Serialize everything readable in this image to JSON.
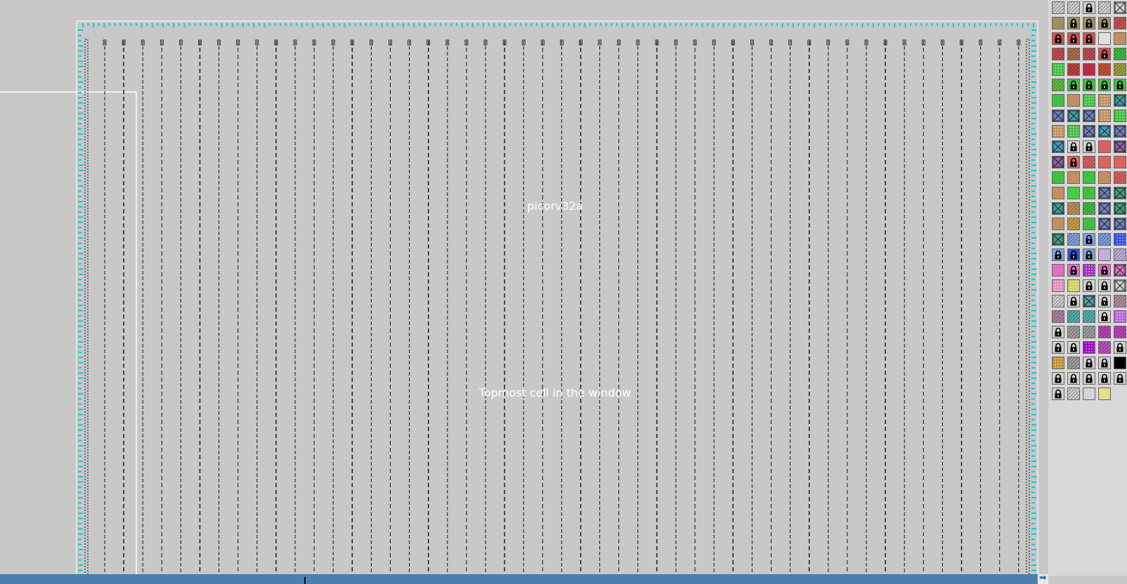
{
  "canvas": {
    "cell_name": "picorv32a",
    "cell_caption": "Topmost cell in the window",
    "colors": {
      "background": "#c8c8c8",
      "cell_border": "#ffffff",
      "io_pin": "#00d0d0",
      "net": "#111111"
    }
  },
  "scrollbar": {
    "right_arrow_icon": "arrow-right-icon",
    "color": "#4a7fb0"
  },
  "palette": {
    "layers": [
      {
        "color": "#d0d0d0",
        "pattern": "hatch",
        "locked": false
      },
      {
        "color": "#d0d0d0",
        "pattern": "hatch",
        "locked": false
      },
      {
        "color": "#d0d0d0",
        "pattern": "solid",
        "locked": true
      },
      {
        "color": "#d0d0d0",
        "pattern": "hatch",
        "locked": false
      },
      {
        "color": "#d0d0d0",
        "pattern": "cross",
        "locked": false
      },
      {
        "color": "#a09060",
        "pattern": "solid",
        "locked": false
      },
      {
        "color": "#a09060",
        "pattern": "solid",
        "locked": true
      },
      {
        "color": "#a09060",
        "pattern": "solid",
        "locked": true
      },
      {
        "color": "#a09060",
        "pattern": "solid",
        "locked": true
      },
      {
        "color": "#d05050",
        "pattern": "hatch",
        "locked": false
      },
      {
        "color": "#d05050",
        "pattern": "solid",
        "locked": true
      },
      {
        "color": "#d05050",
        "pattern": "solid",
        "locked": true
      },
      {
        "color": "#d05050",
        "pattern": "solid",
        "locked": true
      },
      {
        "color": "#e0e0e0",
        "pattern": "solid",
        "locked": false
      },
      {
        "color": "#c09060",
        "pattern": "solid",
        "locked": false
      },
      {
        "color": "#c05050",
        "pattern": "hatch",
        "locked": false
      },
      {
        "color": "#b07050",
        "pattern": "hatch",
        "locked": false
      },
      {
        "color": "#c05050",
        "pattern": "hatch",
        "locked": false
      },
      {
        "color": "#d05050",
        "pattern": "solid",
        "locked": true
      },
      {
        "color": "#40c040",
        "pattern": "hatch",
        "locked": false
      },
      {
        "color": "#40c040",
        "pattern": "dots",
        "locked": false
      },
      {
        "color": "#c04040",
        "pattern": "hatch",
        "locked": false
      },
      {
        "color": "#d03050",
        "pattern": "hatch",
        "locked": false
      },
      {
        "color": "#d05030",
        "pattern": "hatch",
        "locked": false
      },
      {
        "color": "#a0a040",
        "pattern": "hatch",
        "locked": false
      },
      {
        "color": "#60c040",
        "pattern": "hatch",
        "locked": false
      },
      {
        "color": "#40c040",
        "pattern": "solid",
        "locked": true
      },
      {
        "color": "#40c040",
        "pattern": "solid",
        "locked": true
      },
      {
        "color": "#40c040",
        "pattern": "solid",
        "locked": true
      },
      {
        "color": "#40c040",
        "pattern": "solid",
        "locked": true
      },
      {
        "color": "#40c040",
        "pattern": "solid",
        "locked": false
      },
      {
        "color": "#c09060",
        "pattern": "solid",
        "locked": false
      },
      {
        "color": "#40c040",
        "pattern": "dots",
        "locked": false
      },
      {
        "color": "#c09060",
        "pattern": "dots",
        "locked": false
      },
      {
        "color": "#40a0a0",
        "pattern": "cross",
        "locked": false
      },
      {
        "color": "#7080c0",
        "pattern": "cross",
        "locked": false
      },
      {
        "color": "#40a0a0",
        "pattern": "cross",
        "locked": false
      },
      {
        "color": "#7080c0",
        "pattern": "cross",
        "locked": false
      },
      {
        "color": "#c09060",
        "pattern": "dots",
        "locked": false
      },
      {
        "color": "#40c040",
        "pattern": "dots",
        "locked": false
      },
      {
        "color": "#c09060",
        "pattern": "dots",
        "locked": false
      },
      {
        "color": "#40c040",
        "pattern": "dots",
        "locked": false
      },
      {
        "color": "#7080c0",
        "pattern": "cross",
        "locked": false
      },
      {
        "color": "#40a0c0",
        "pattern": "cross",
        "locked": false
      },
      {
        "color": "#7080c0",
        "pattern": "cross",
        "locked": false
      },
      {
        "color": "#40a0c0",
        "pattern": "cross",
        "locked": false
      },
      {
        "color": "#d0d0d0",
        "pattern": "solid",
        "locked": true
      },
      {
        "color": "#d0d0d0",
        "pattern": "solid",
        "locked": true
      },
      {
        "color": "#e06060",
        "pattern": "solid",
        "locked": false
      },
      {
        "color": "#9060a0",
        "pattern": "cross",
        "locked": false
      },
      {
        "color": "#9060a0",
        "pattern": "cross",
        "locked": false
      },
      {
        "color": "#e06060",
        "pattern": "solid",
        "locked": true
      },
      {
        "color": "#e06060",
        "pattern": "hatch",
        "locked": false
      },
      {
        "color": "#e06060",
        "pattern": "solid",
        "locked": false
      },
      {
        "color": "#e06060",
        "pattern": "solid",
        "locked": false
      },
      {
        "color": "#40c040",
        "pattern": "solid",
        "locked": false
      },
      {
        "color": "#c09060",
        "pattern": "solid",
        "locked": false
      },
      {
        "color": "#40c040",
        "pattern": "solid",
        "locked": false
      },
      {
        "color": "#c09060",
        "pattern": "solid",
        "locked": false
      },
      {
        "color": "#e06060",
        "pattern": "hatch",
        "locked": false
      },
      {
        "color": "#c09060",
        "pattern": "solid",
        "locked": false
      },
      {
        "color": "#40d040",
        "pattern": "solid",
        "locked": false
      },
      {
        "color": "#40c040",
        "pattern": "solid",
        "locked": false
      },
      {
        "color": "#7080c0",
        "pattern": "cross",
        "locked": false
      },
      {
        "color": "#40a080",
        "pattern": "cross",
        "locked": false
      },
      {
        "color": "#40a0a0",
        "pattern": "cross",
        "locked": false
      },
      {
        "color": "#c09060",
        "pattern": "hatch",
        "locked": false
      },
      {
        "color": "#40c040",
        "pattern": "hatch",
        "locked": false
      },
      {
        "color": "#7080c0",
        "pattern": "cross",
        "locked": false
      },
      {
        "color": "#40a080",
        "pattern": "cross",
        "locked": false
      },
      {
        "color": "#c09060",
        "pattern": "solid",
        "locked": false
      },
      {
        "color": "#d0a040",
        "pattern": "hatch",
        "locked": false
      },
      {
        "color": "#40c040",
        "pattern": "solid",
        "locked": false
      },
      {
        "color": "#7080c0",
        "pattern": "cross",
        "locked": false
      },
      {
        "color": "#7080c0",
        "pattern": "cross",
        "locked": false
      },
      {
        "color": "#40a080",
        "pattern": "cross",
        "locked": false
      },
      {
        "color": "#80a0e0",
        "pattern": "hatch",
        "locked": false
      },
      {
        "color": "#80a0e0",
        "pattern": "solid",
        "locked": true
      },
      {
        "color": "#80a0e0",
        "pattern": "hatch",
        "locked": false
      },
      {
        "color": "#3050e0",
        "pattern": "dots",
        "locked": false
      },
      {
        "color": "#80a0e0",
        "pattern": "solid",
        "locked": true
      },
      {
        "color": "#3050e0",
        "pattern": "solid",
        "locked": true
      },
      {
        "color": "#80a0e0",
        "pattern": "solid",
        "locked": true
      },
      {
        "color": "#c0b0e0",
        "pattern": "solid",
        "locked": false
      },
      {
        "color": "#c0b0e0",
        "pattern": "hatch",
        "locked": false
      },
      {
        "color": "#e070c0",
        "pattern": "solid",
        "locked": false
      },
      {
        "color": "#e070c0",
        "pattern": "solid",
        "locked": true
      },
      {
        "color": "#a030c0",
        "pattern": "dots",
        "locked": false
      },
      {
        "color": "#e070c0",
        "pattern": "solid",
        "locked": true
      },
      {
        "color": "#e070c0",
        "pattern": "cross",
        "locked": false
      },
      {
        "color": "#e090c0",
        "pattern": "dots",
        "locked": false
      },
      {
        "color": "#d0d060",
        "pattern": "dots",
        "locked": false
      },
      {
        "color": "#d0d0d0",
        "pattern": "solid",
        "locked": true
      },
      {
        "color": "#d0d0d0",
        "pattern": "solid",
        "locked": true
      },
      {
        "color": "#d0d0d0",
        "pattern": "cross",
        "locked": false
      },
      {
        "color": "#d0d0d0",
        "pattern": "hatch",
        "locked": false
      },
      {
        "color": "#d0d0d0",
        "pattern": "solid",
        "locked": true
      },
      {
        "color": "#50a0a0",
        "pattern": "cross",
        "locked": false
      },
      {
        "color": "#d0d0d0",
        "pattern": "solid",
        "locked": true
      },
      {
        "color": "#b090a0",
        "pattern": "hatch",
        "locked": false
      },
      {
        "color": "#b080a0",
        "pattern": "hatch",
        "locked": false
      },
      {
        "color": "#50b0b0",
        "pattern": "hatch",
        "locked": false
      },
      {
        "color": "#50b0b0",
        "pattern": "hatch",
        "locked": false
      },
      {
        "color": "#d0d0d0",
        "pattern": "solid",
        "locked": true
      },
      {
        "color": "#c060e0",
        "pattern": "dots",
        "locked": false
      },
      {
        "color": "#d0d0d0",
        "pattern": "solid",
        "locked": true
      },
      {
        "color": "#a0a0a0",
        "pattern": "hatch",
        "locked": false
      },
      {
        "color": "#a0a0a0",
        "pattern": "hatch",
        "locked": false
      },
      {
        "color": "#c040c0",
        "pattern": "hatch",
        "locked": false
      },
      {
        "color": "#c040c0",
        "pattern": "hatch",
        "locked": false
      },
      {
        "color": "#d0d0d0",
        "pattern": "solid",
        "locked": true
      },
      {
        "color": "#d0d0d0",
        "pattern": "solid",
        "locked": true
      },
      {
        "color": "#a000c0",
        "pattern": "dots",
        "locked": false
      },
      {
        "color": "#c050c0",
        "pattern": "hatch",
        "locked": false
      },
      {
        "color": "#d0d0d0",
        "pattern": "solid",
        "locked": true
      },
      {
        "color": "#c09030",
        "pattern": "dots",
        "locked": false
      },
      {
        "color": "#a0a0a0",
        "pattern": "hatch",
        "locked": false
      },
      {
        "color": "#d0d0d0",
        "pattern": "solid",
        "locked": true
      },
      {
        "color": "#d0d0d0",
        "pattern": "solid",
        "locked": true
      },
      {
        "color": "#000000",
        "pattern": "solid",
        "locked": false
      },
      {
        "color": "#d0d0d0",
        "pattern": "solid",
        "locked": true
      },
      {
        "color": "#d0d0d0",
        "pattern": "solid",
        "locked": true
      },
      {
        "color": "#d0d0d0",
        "pattern": "solid",
        "locked": true
      },
      {
        "color": "#d0d0d0",
        "pattern": "solid",
        "locked": true
      },
      {
        "color": "#d0d0d0",
        "pattern": "solid",
        "locked": true
      },
      {
        "color": "#d0d0d0",
        "pattern": "solid",
        "locked": true
      },
      {
        "color": "#d0d0d0",
        "pattern": "hatch",
        "locked": false
      },
      {
        "color": "#d0d0d0",
        "pattern": "dots",
        "locked": false
      },
      {
        "color": "#e0e090",
        "pattern": "solid",
        "locked": false
      }
    ]
  }
}
